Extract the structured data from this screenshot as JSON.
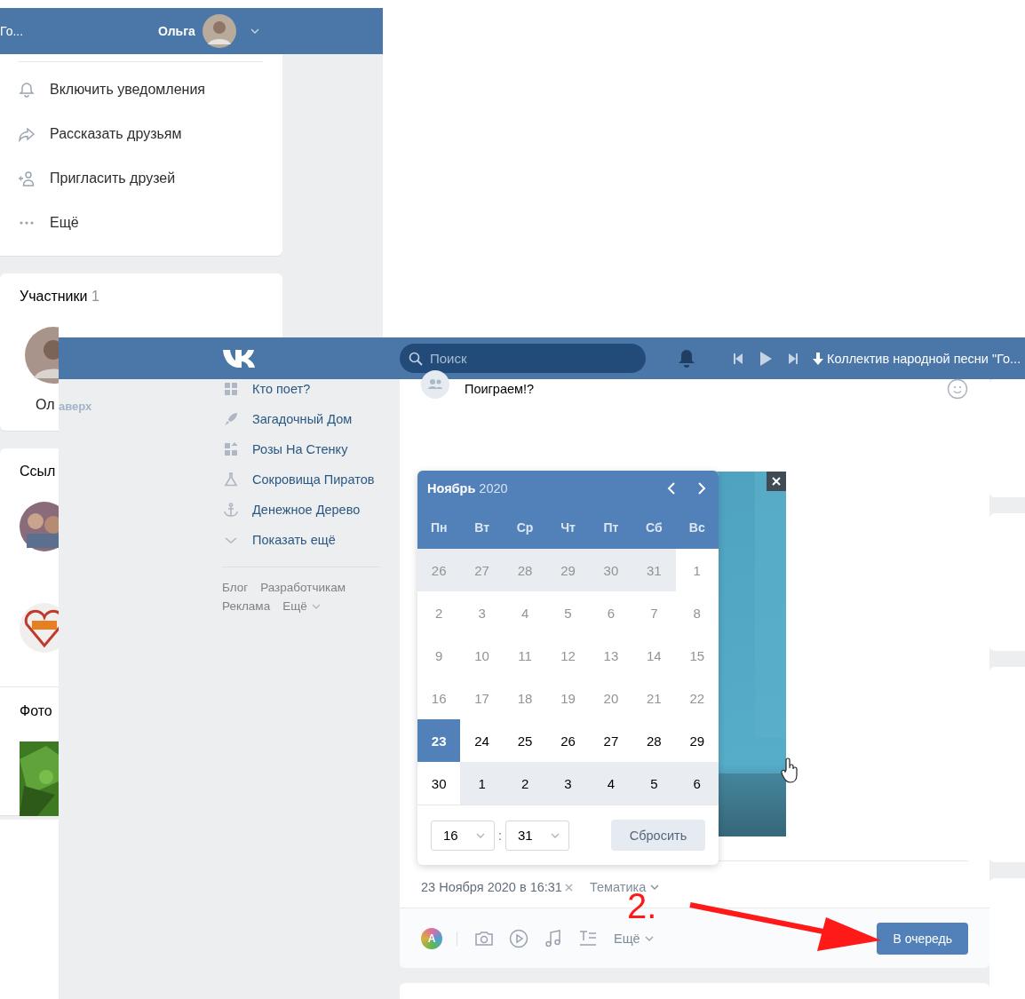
{
  "back_screenshot": {
    "header": {
      "track_text": "Го...",
      "user_name": "Ольга"
    },
    "actions": [
      {
        "kind": "bell",
        "label": "Включить уведомления"
      },
      {
        "kind": "share",
        "label": "Рассказать друзьям"
      },
      {
        "kind": "invite",
        "label": "Пригласить друзей"
      },
      {
        "kind": "dots",
        "label": "Ещё"
      }
    ],
    "members": {
      "title": "Участники",
      "count": "1",
      "member_name": "Ол"
    },
    "links": {
      "title": "Ссыл"
    },
    "photos": {
      "title": "Фото"
    }
  },
  "front_screenshot": {
    "header": {
      "search_placeholder": "Поиск",
      "now_playing": "Коллектив народной песни \"Го..."
    },
    "back_to_top": "аверх",
    "sidebar": {
      "items": [
        {
          "kind": "grid",
          "label": "Кто поет?"
        },
        {
          "kind": "rocket",
          "label": "Загадочный Дом"
        },
        {
          "kind": "grid-plus",
          "label": "Розы На Стенку"
        },
        {
          "kind": "flask",
          "label": "Сокровища Пиратов"
        },
        {
          "kind": "anchor",
          "label": "Денежное Дерево"
        },
        {
          "kind": "chevron",
          "label": "Показать ещё"
        }
      ],
      "footer_links": [
        "Блог",
        "Разработчикам",
        "Реклама",
        "Ещё"
      ]
    },
    "post": {
      "text": "Поиграем!?",
      "schedule": "23 Ноября 2020 в 16:31",
      "topic": "Тематика",
      "poster_letter": "A",
      "more": "Ещё",
      "submit": "В очередь"
    },
    "calendar": {
      "month": "Ноябрь",
      "year": "2020",
      "weekdays": [
        "Пн",
        "Вт",
        "Ср",
        "Чт",
        "Пт",
        "Сб",
        "Вс"
      ],
      "weeks": [
        [
          {
            "day": "26",
            "other_month": true,
            "past": true,
            "selected": false
          },
          {
            "day": "27",
            "other_month": true,
            "past": true,
            "selected": false
          },
          {
            "day": "28",
            "other_month": true,
            "past": true,
            "selected": false
          },
          {
            "day": "29",
            "other_month": true,
            "past": true,
            "selected": false
          },
          {
            "day": "30",
            "other_month": true,
            "past": true,
            "selected": false
          },
          {
            "day": "31",
            "other_month": true,
            "past": true,
            "selected": false
          },
          {
            "day": "1",
            "other_month": false,
            "past": true,
            "selected": false
          }
        ],
        [
          {
            "day": "2",
            "other_month": false,
            "past": true,
            "selected": false
          },
          {
            "day": "3",
            "other_month": false,
            "past": true,
            "selected": false
          },
          {
            "day": "4",
            "other_month": false,
            "past": true,
            "selected": false
          },
          {
            "day": "5",
            "other_month": false,
            "past": true,
            "selected": false
          },
          {
            "day": "6",
            "other_month": false,
            "past": true,
            "selected": false
          },
          {
            "day": "7",
            "other_month": false,
            "past": true,
            "selected": false
          },
          {
            "day": "8",
            "other_month": false,
            "past": true,
            "selected": false
          }
        ],
        [
          {
            "day": "9",
            "other_month": false,
            "past": true,
            "selected": false
          },
          {
            "day": "10",
            "other_month": false,
            "past": true,
            "selected": false
          },
          {
            "day": "11",
            "other_month": false,
            "past": true,
            "selected": false
          },
          {
            "day": "12",
            "other_month": false,
            "past": true,
            "selected": false
          },
          {
            "day": "13",
            "other_month": false,
            "past": true,
            "selected": false
          },
          {
            "day": "14",
            "other_month": false,
            "past": true,
            "selected": false
          },
          {
            "day": "15",
            "other_month": false,
            "past": true,
            "selected": false
          }
        ],
        [
          {
            "day": "16",
            "other_month": false,
            "past": true,
            "selected": false
          },
          {
            "day": "17",
            "other_month": false,
            "past": true,
            "selected": false
          },
          {
            "day": "18",
            "other_month": false,
            "past": true,
            "selected": false
          },
          {
            "day": "19",
            "other_month": false,
            "past": true,
            "selected": false
          },
          {
            "day": "20",
            "other_month": false,
            "past": true,
            "selected": false
          },
          {
            "day": "21",
            "other_month": false,
            "past": true,
            "selected": false
          },
          {
            "day": "22",
            "other_month": false,
            "past": true,
            "selected": false
          }
        ],
        [
          {
            "day": "23",
            "other_month": false,
            "past": false,
            "selected": true
          },
          {
            "day": "24",
            "other_month": false,
            "past": false,
            "selected": false
          },
          {
            "day": "25",
            "other_month": false,
            "past": false,
            "selected": false
          },
          {
            "day": "26",
            "other_month": false,
            "past": false,
            "selected": false
          },
          {
            "day": "27",
            "other_month": false,
            "past": false,
            "selected": false
          },
          {
            "day": "28",
            "other_month": false,
            "past": false,
            "selected": false
          },
          {
            "day": "29",
            "other_month": false,
            "past": false,
            "selected": false
          }
        ],
        [
          {
            "day": "30",
            "other_month": false,
            "past": false,
            "selected": false
          },
          {
            "day": "1",
            "other_month": true,
            "past": false,
            "selected": false
          },
          {
            "day": "2",
            "other_month": true,
            "past": false,
            "selected": false
          },
          {
            "day": "3",
            "other_month": true,
            "past": false,
            "selected": false
          },
          {
            "day": "4",
            "other_month": true,
            "past": false,
            "selected": false
          },
          {
            "day": "5",
            "other_month": true,
            "past": false,
            "selected": false
          },
          {
            "day": "6",
            "other_month": true,
            "past": false,
            "selected": false
          }
        ]
      ],
      "hour": "16",
      "separator": ":",
      "minute": "31",
      "reset": "Сбросить"
    }
  },
  "annotation": {
    "step": "2."
  }
}
